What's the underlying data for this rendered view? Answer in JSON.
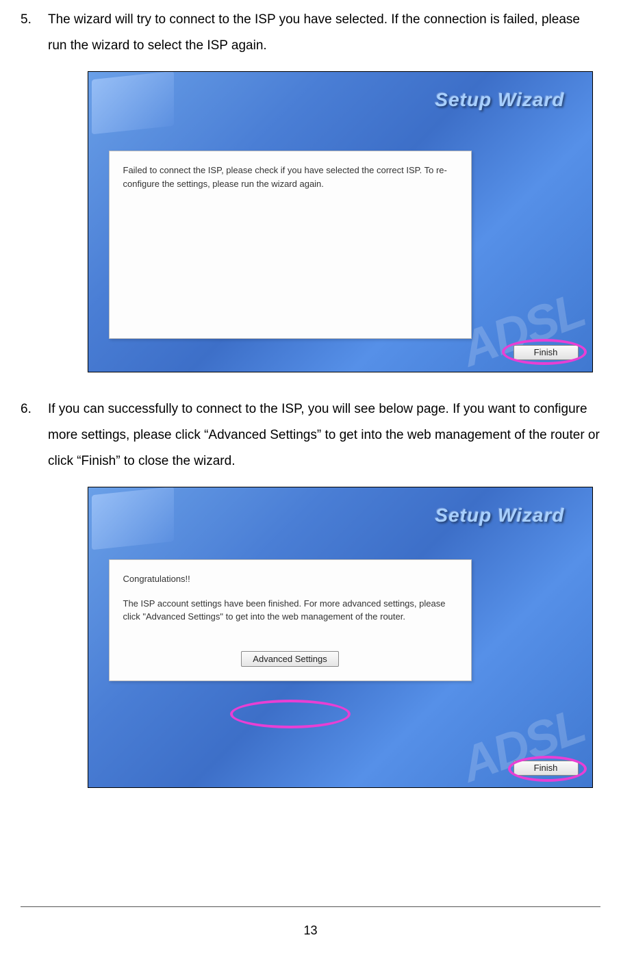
{
  "steps": {
    "s5": {
      "num": "5.",
      "text": "The wizard will try to connect to the ISP you have selected. If the connection is failed, please run the wizard to select the ISP again."
    },
    "s6": {
      "num": "6.",
      "text": "If you can successfully to connect to the ISP, you will see below page. If you want to configure more settings, please click “Advanced Settings” to get into the web management of the router or click “Finish” to close the wizard."
    }
  },
  "wizard": {
    "title": "Setup Wizard",
    "watermark": "ADSL",
    "fail_msg": "Failed to connect the ISP, please check if you have selected the correct ISP. To re-configure the settings, please run the wizard again.",
    "success_heading": "Congratulations!!",
    "success_msg": "The ISP account settings have been finished. For more advanced settings, please click \"Advanced Settings\" to get into the web management of the router.",
    "advanced_btn": "Advanced Settings",
    "finish_btn": "Finish"
  },
  "page_number": "13"
}
